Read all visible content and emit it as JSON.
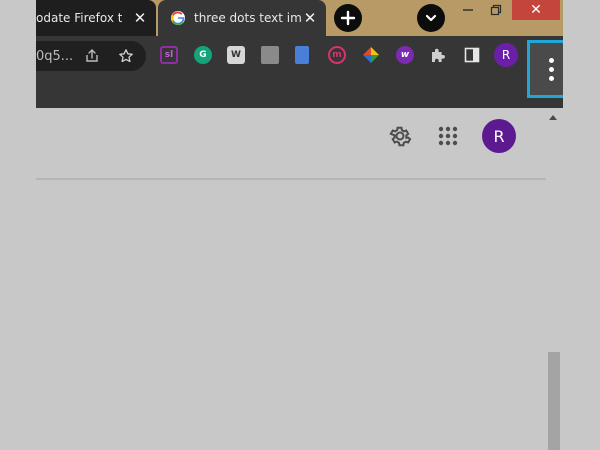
{
  "tabs": [
    {
      "title": "odate Firefox to",
      "close_glyph": "✕"
    },
    {
      "title": "three dots text ima",
      "close_glyph": "✕"
    }
  ],
  "tabstrip": {
    "new_tab_glyph": "+",
    "tab_search_glyph": "⌄"
  },
  "window_controls": {
    "minimize_glyph": "—",
    "maximize_glyph": "❐",
    "close_glyph": "✕"
  },
  "omnibox": {
    "url_fragment": "0q5..."
  },
  "extensions": [
    {
      "name": "ext-sl",
      "label": "sl",
      "color": "#8e2fa3"
    },
    {
      "name": "grammarly",
      "label": "G",
      "color": "#15a37a"
    },
    {
      "name": "ext-w",
      "label": "W",
      "color": "#d6d6d6"
    },
    {
      "name": "ext-s",
      "label": "",
      "color": "#8a8a8a"
    },
    {
      "name": "ext-doc",
      "label": "",
      "color": "#4a7fd8"
    },
    {
      "name": "ext-m",
      "label": "m",
      "color": "#d9326f"
    },
    {
      "name": "ext-colors",
      "label": "",
      "color": "#e04b2b"
    },
    {
      "name": "ext-w2",
      "label": "w",
      "color": "#7a2bb0"
    }
  ],
  "profile": {
    "initial": "R",
    "color": "#6b1fa8"
  },
  "page": {
    "account_initial": "R",
    "account_color": "#5d1a90"
  },
  "accent": {
    "highlight_border": "#21a6d8",
    "close_red": "#c4453c"
  }
}
